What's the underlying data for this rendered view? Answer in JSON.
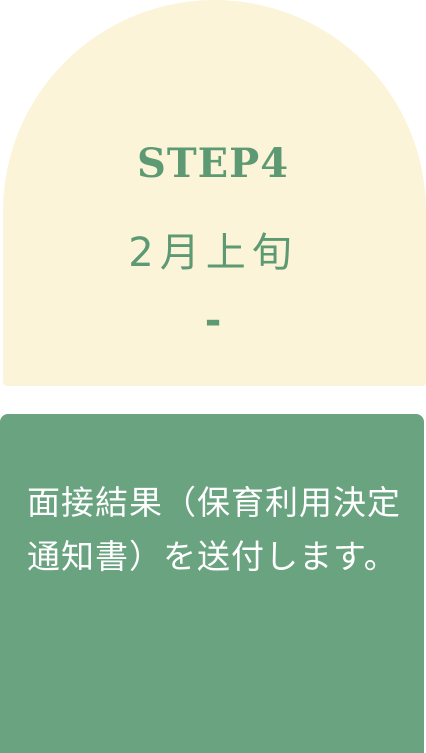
{
  "step": {
    "label": "STEP4",
    "date": "2月上旬",
    "separator": "-"
  },
  "description": "面接結果（保育利用決定通知書）を送付します。",
  "colors": {
    "cream": "#fbf4d8",
    "green": "#6aa380",
    "text_green": "#5d9a73"
  }
}
